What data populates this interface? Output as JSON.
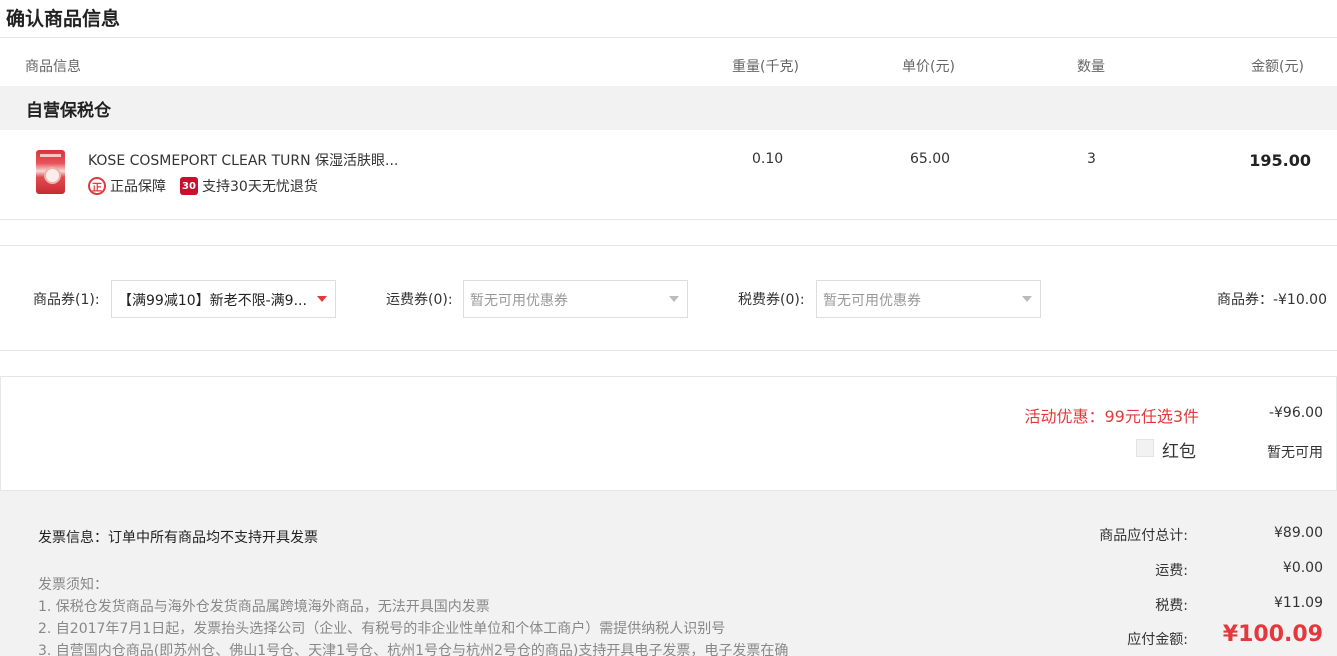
{
  "page": {
    "title": "确认商品信息"
  },
  "table": {
    "headers": {
      "product": "商品信息",
      "weight": "重量(千克)",
      "unit_price": "单价(元)",
      "quantity": "数量",
      "amount": "金额(元)"
    }
  },
  "warehouse": {
    "name": "自营保税仓"
  },
  "product": {
    "thumbnail_icon": "product-thumbnail",
    "name": "KOSE COSMEPORT CLEAR TURN 保湿活肤眼...",
    "badges": [
      {
        "icon": "genuine-icon",
        "icon_text": "正",
        "label": "正品保障"
      },
      {
        "icon": "return-30-icon",
        "icon_text": "30",
        "label": "支持30天无忧退货"
      }
    ],
    "weight": "0.10",
    "unit_price": "65.00",
    "quantity": "3",
    "amount": "195.00"
  },
  "coupons": {
    "goods": {
      "label": "商品券(1):",
      "selected": "【满99减10】新老不限-满9..."
    },
    "shipping": {
      "label": "运费券(0):",
      "placeholder": "暂无可用优惠券"
    },
    "tax": {
      "label": "税费券(0):",
      "placeholder": "暂无可用优惠券"
    },
    "summary": "商品券：-¥10.00"
  },
  "promotion": {
    "label": "活动优惠：99元任选3件",
    "value": "-¥96.00",
    "red_packet_label": "红包",
    "red_packet_status": "暂无可用"
  },
  "invoice": {
    "info": "发票信息：订单中所有商品均不支持开具发票",
    "notice_title": "发票须知：",
    "notices": [
      "1. 保税仓发货商品与海外仓发货商品属跨境海外商品，无法开具国内发票",
      "2. 自2017年7月1日起，发票抬头选择公司（企业、有税号的非企业性单位和个体工商户）需提供纳税人识别号",
      "3. 自营国内仓商品(即苏州仓、佛山1号仓、天津1号仓、杭州1号仓与杭州2号仓的商品)支持开具电子发票，电子发票在确"
    ]
  },
  "summary": {
    "goods_total_label": "商品应付总计:",
    "goods_total": "¥89.00",
    "shipping_label": "运费:",
    "shipping": "¥0.00",
    "tax_label": "税费:",
    "tax": "¥11.09",
    "payable_label": "应付金额:",
    "payable": "¥100.09"
  },
  "colors": {
    "accent": "#e4393c",
    "panel": "#f2f2f2",
    "border": "#e6e6e6"
  }
}
